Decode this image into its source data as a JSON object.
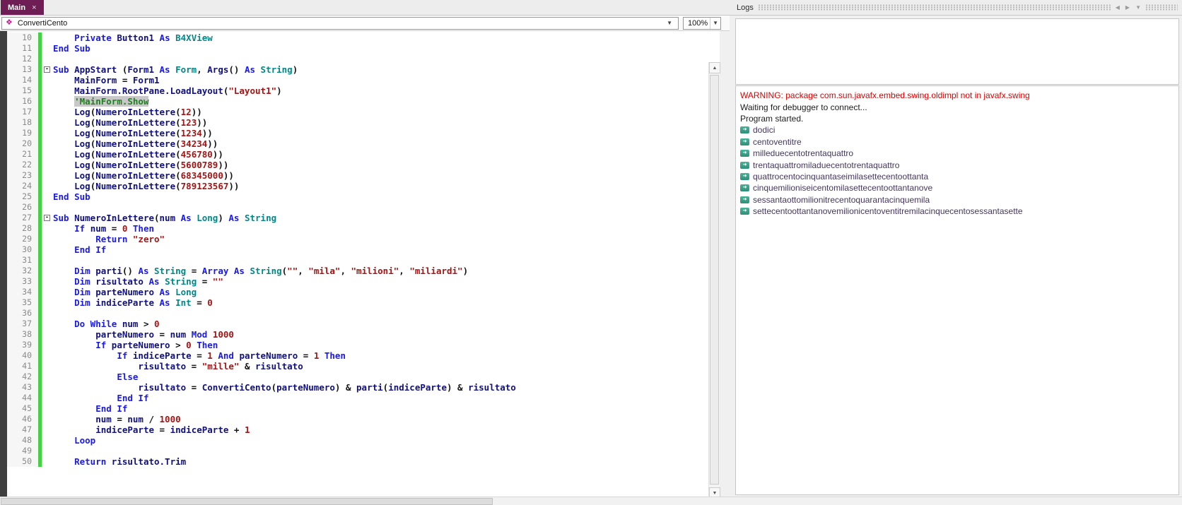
{
  "header": {
    "tabs": [
      {
        "label": "Main",
        "close_glyph": "×"
      }
    ],
    "nav": {
      "prev_glyph": "◀",
      "next_glyph": "▶",
      "menu_glyph": "▼"
    }
  },
  "toolbar": {
    "sub_selector_value": "ConvertiCento",
    "sub_icon_glyph": "❖",
    "zoom_value": "100%",
    "dropdown_glyph": "▼"
  },
  "scroll": {
    "up_glyph": "▲",
    "down_glyph": "▼"
  },
  "colors": {
    "active_tab_bg": "#6e1d55",
    "keyword": "#1a1ae6",
    "type": "#008888",
    "identifier": "#10107e",
    "literal": "#a31515",
    "comment": "#1e801e",
    "comment_highlight_bg": "#c8c8c8",
    "change_bar": "#44d144",
    "warning_text": "#dc0000",
    "log_output_text": "#44365e",
    "sub_icon": "#bf1d95"
  },
  "editor": {
    "fold_glyph": "-",
    "lines": [
      {
        "n": 10,
        "g": true,
        "f": false,
        "tk": [
          [
            "p",
            "    "
          ],
          [
            "k",
            "Private "
          ],
          [
            "i",
            "Button1 "
          ],
          [
            "k",
            "As "
          ],
          [
            "y",
            "B4XView"
          ]
        ]
      },
      {
        "n": 11,
        "g": true,
        "f": false,
        "tk": [
          [
            "k",
            "End Sub"
          ]
        ]
      },
      {
        "n": 12,
        "g": true,
        "f": false,
        "tk": []
      },
      {
        "n": 13,
        "g": true,
        "f": true,
        "tk": [
          [
            "k",
            "Sub "
          ],
          [
            "i",
            "AppStart "
          ],
          [
            "p",
            "("
          ],
          [
            "i",
            "Form1 "
          ],
          [
            "k",
            "As "
          ],
          [
            "y",
            "Form"
          ],
          [
            "p",
            ", "
          ],
          [
            "i",
            "Args"
          ],
          [
            "p",
            "() "
          ],
          [
            "k",
            "As "
          ],
          [
            "y",
            "String"
          ],
          [
            "p",
            ")"
          ]
        ]
      },
      {
        "n": 14,
        "g": true,
        "f": false,
        "tk": [
          [
            "p",
            "    "
          ],
          [
            "i",
            "MainForm"
          ],
          [
            "p",
            " = "
          ],
          [
            "i",
            "Form1"
          ]
        ]
      },
      {
        "n": 15,
        "g": true,
        "f": false,
        "tk": [
          [
            "p",
            "    "
          ],
          [
            "i",
            "MainForm.RootPane.LoadLayout"
          ],
          [
            "p",
            "("
          ],
          [
            "s",
            "\"Layout1\""
          ],
          [
            "p",
            ")"
          ]
        ]
      },
      {
        "n": 16,
        "g": true,
        "f": false,
        "tk": [
          [
            "p",
            "    "
          ],
          [
            "h",
            "'MainForm.Show"
          ]
        ]
      },
      {
        "n": 17,
        "g": true,
        "f": false,
        "tk": [
          [
            "p",
            "    "
          ],
          [
            "i",
            "Log"
          ],
          [
            "p",
            "("
          ],
          [
            "i",
            "NumeroInLettere"
          ],
          [
            "p",
            "("
          ],
          [
            "n",
            "12"
          ],
          [
            "p",
            "))"
          ]
        ]
      },
      {
        "n": 18,
        "g": true,
        "f": false,
        "tk": [
          [
            "p",
            "    "
          ],
          [
            "i",
            "Log"
          ],
          [
            "p",
            "("
          ],
          [
            "i",
            "NumeroInLettere"
          ],
          [
            "p",
            "("
          ],
          [
            "n",
            "123"
          ],
          [
            "p",
            "))"
          ]
        ]
      },
      {
        "n": 19,
        "g": true,
        "f": false,
        "tk": [
          [
            "p",
            "    "
          ],
          [
            "i",
            "Log"
          ],
          [
            "p",
            "("
          ],
          [
            "i",
            "NumeroInLettere"
          ],
          [
            "p",
            "("
          ],
          [
            "n",
            "1234"
          ],
          [
            "p",
            "))"
          ]
        ]
      },
      {
        "n": 20,
        "g": true,
        "f": false,
        "tk": [
          [
            "p",
            "    "
          ],
          [
            "i",
            "Log"
          ],
          [
            "p",
            "("
          ],
          [
            "i",
            "NumeroInLettere"
          ],
          [
            "p",
            "("
          ],
          [
            "n",
            "34234"
          ],
          [
            "p",
            "))"
          ]
        ]
      },
      {
        "n": 21,
        "g": true,
        "f": false,
        "tk": [
          [
            "p",
            "    "
          ],
          [
            "i",
            "Log"
          ],
          [
            "p",
            "("
          ],
          [
            "i",
            "NumeroInLettere"
          ],
          [
            "p",
            "("
          ],
          [
            "n",
            "456780"
          ],
          [
            "p",
            "))"
          ]
        ]
      },
      {
        "n": 22,
        "g": true,
        "f": false,
        "tk": [
          [
            "p",
            "    "
          ],
          [
            "i",
            "Log"
          ],
          [
            "p",
            "("
          ],
          [
            "i",
            "NumeroInLettere"
          ],
          [
            "p",
            "("
          ],
          [
            "n",
            "5600789"
          ],
          [
            "p",
            "))"
          ]
        ]
      },
      {
        "n": 23,
        "g": true,
        "f": false,
        "tk": [
          [
            "p",
            "    "
          ],
          [
            "i",
            "Log"
          ],
          [
            "p",
            "("
          ],
          [
            "i",
            "NumeroInLettere"
          ],
          [
            "p",
            "("
          ],
          [
            "n",
            "68345000"
          ],
          [
            "p",
            "))"
          ]
        ]
      },
      {
        "n": 24,
        "g": true,
        "f": false,
        "tk": [
          [
            "p",
            "    "
          ],
          [
            "i",
            "Log"
          ],
          [
            "p",
            "("
          ],
          [
            "i",
            "NumeroInLettere"
          ],
          [
            "p",
            "("
          ],
          [
            "n",
            "789123567"
          ],
          [
            "p",
            "))"
          ]
        ]
      },
      {
        "n": 25,
        "g": true,
        "f": false,
        "tk": [
          [
            "k",
            "End Sub"
          ]
        ]
      },
      {
        "n": 26,
        "g": true,
        "f": false,
        "tk": []
      },
      {
        "n": 27,
        "g": true,
        "f": true,
        "tk": [
          [
            "k",
            "Sub "
          ],
          [
            "i",
            "NumeroInLettere"
          ],
          [
            "p",
            "("
          ],
          [
            "i",
            "num "
          ],
          [
            "k",
            "As "
          ],
          [
            "y",
            "Long"
          ],
          [
            "p",
            ") "
          ],
          [
            "k",
            "As "
          ],
          [
            "y",
            "String"
          ]
        ]
      },
      {
        "n": 28,
        "g": true,
        "f": false,
        "tk": [
          [
            "p",
            "    "
          ],
          [
            "k",
            "If "
          ],
          [
            "i",
            "num"
          ],
          [
            "p",
            " = "
          ],
          [
            "n",
            "0"
          ],
          [
            "k",
            " Then"
          ]
        ]
      },
      {
        "n": 29,
        "g": true,
        "f": false,
        "tk": [
          [
            "p",
            "        "
          ],
          [
            "k",
            "Return "
          ],
          [
            "s",
            "\"zero\""
          ]
        ]
      },
      {
        "n": 30,
        "g": true,
        "f": false,
        "tk": [
          [
            "p",
            "    "
          ],
          [
            "k",
            "End If"
          ]
        ]
      },
      {
        "n": 31,
        "g": true,
        "f": false,
        "tk": []
      },
      {
        "n": 32,
        "g": true,
        "f": false,
        "tk": [
          [
            "p",
            "    "
          ],
          [
            "k",
            "Dim "
          ],
          [
            "i",
            "parti"
          ],
          [
            "p",
            "() "
          ],
          [
            "k",
            "As "
          ],
          [
            "y",
            "String"
          ],
          [
            "p",
            " = "
          ],
          [
            "k",
            "Array As "
          ],
          [
            "y",
            "String"
          ],
          [
            "p",
            "("
          ],
          [
            "s",
            "\"\""
          ],
          [
            "p",
            ", "
          ],
          [
            "s",
            "\"mila\""
          ],
          [
            "p",
            ", "
          ],
          [
            "s",
            "\"milioni\""
          ],
          [
            "p",
            ", "
          ],
          [
            "s",
            "\"miliardi\""
          ],
          [
            "p",
            ")"
          ]
        ]
      },
      {
        "n": 33,
        "g": true,
        "f": false,
        "tk": [
          [
            "p",
            "    "
          ],
          [
            "k",
            "Dim "
          ],
          [
            "i",
            "risultato "
          ],
          [
            "k",
            "As "
          ],
          [
            "y",
            "String"
          ],
          [
            "p",
            " = "
          ],
          [
            "s",
            "\"\""
          ]
        ]
      },
      {
        "n": 34,
        "g": true,
        "f": false,
        "tk": [
          [
            "p",
            "    "
          ],
          [
            "k",
            "Dim "
          ],
          [
            "i",
            "parteNumero "
          ],
          [
            "k",
            "As "
          ],
          [
            "y",
            "Long"
          ]
        ]
      },
      {
        "n": 35,
        "g": true,
        "f": false,
        "tk": [
          [
            "p",
            "    "
          ],
          [
            "k",
            "Dim "
          ],
          [
            "i",
            "indiceParte "
          ],
          [
            "k",
            "As "
          ],
          [
            "y",
            "Int"
          ],
          [
            "p",
            " = "
          ],
          [
            "n",
            "0"
          ]
        ]
      },
      {
        "n": 36,
        "g": true,
        "f": false,
        "tk": []
      },
      {
        "n": 37,
        "g": true,
        "f": false,
        "tk": [
          [
            "p",
            "    "
          ],
          [
            "k",
            "Do While "
          ],
          [
            "i",
            "num"
          ],
          [
            "p",
            " > "
          ],
          [
            "n",
            "0"
          ]
        ]
      },
      {
        "n": 38,
        "g": true,
        "f": false,
        "tk": [
          [
            "p",
            "        "
          ],
          [
            "i",
            "parteNumero"
          ],
          [
            "p",
            " = "
          ],
          [
            "i",
            "num "
          ],
          [
            "k",
            "Mod "
          ],
          [
            "n",
            "1000"
          ]
        ]
      },
      {
        "n": 39,
        "g": true,
        "f": false,
        "tk": [
          [
            "p",
            "        "
          ],
          [
            "k",
            "If "
          ],
          [
            "i",
            "parteNumero"
          ],
          [
            "p",
            " > "
          ],
          [
            "n",
            "0"
          ],
          [
            "k",
            " Then"
          ]
        ]
      },
      {
        "n": 40,
        "g": true,
        "f": false,
        "tk": [
          [
            "p",
            "            "
          ],
          [
            "k",
            "If "
          ],
          [
            "i",
            "indiceParte"
          ],
          [
            "p",
            " = "
          ],
          [
            "n",
            "1"
          ],
          [
            "k",
            " And "
          ],
          [
            "i",
            "parteNumero"
          ],
          [
            "p",
            " = "
          ],
          [
            "n",
            "1"
          ],
          [
            "k",
            " Then"
          ]
        ]
      },
      {
        "n": 41,
        "g": true,
        "f": false,
        "tk": [
          [
            "p",
            "                "
          ],
          [
            "i",
            "risultato"
          ],
          [
            "p",
            " = "
          ],
          [
            "s",
            "\"mille\""
          ],
          [
            "p",
            " & "
          ],
          [
            "i",
            "risultato"
          ]
        ]
      },
      {
        "n": 42,
        "g": true,
        "f": false,
        "tk": [
          [
            "p",
            "            "
          ],
          [
            "k",
            "Else"
          ]
        ]
      },
      {
        "n": 43,
        "g": true,
        "f": false,
        "tk": [
          [
            "p",
            "                "
          ],
          [
            "i",
            "risultato"
          ],
          [
            "p",
            " = "
          ],
          [
            "i",
            "ConvertiCento"
          ],
          [
            "p",
            "("
          ],
          [
            "i",
            "parteNumero"
          ],
          [
            "p",
            ") & "
          ],
          [
            "i",
            "parti"
          ],
          [
            "p",
            "("
          ],
          [
            "i",
            "indiceParte"
          ],
          [
            "p",
            ") & "
          ],
          [
            "i",
            "risultato"
          ]
        ]
      },
      {
        "n": 44,
        "g": true,
        "f": false,
        "tk": [
          [
            "p",
            "            "
          ],
          [
            "k",
            "End If"
          ]
        ]
      },
      {
        "n": 45,
        "g": true,
        "f": false,
        "tk": [
          [
            "p",
            "        "
          ],
          [
            "k",
            "End If"
          ]
        ]
      },
      {
        "n": 46,
        "g": true,
        "f": false,
        "tk": [
          [
            "p",
            "        "
          ],
          [
            "i",
            "num"
          ],
          [
            "p",
            " = "
          ],
          [
            "i",
            "num"
          ],
          [
            "p",
            " / "
          ],
          [
            "n",
            "1000"
          ]
        ]
      },
      {
        "n": 47,
        "g": true,
        "f": false,
        "tk": [
          [
            "p",
            "        "
          ],
          [
            "i",
            "indiceParte"
          ],
          [
            "p",
            " = "
          ],
          [
            "i",
            "indiceParte"
          ],
          [
            "p",
            " + "
          ],
          [
            "n",
            "1"
          ]
        ]
      },
      {
        "n": 48,
        "g": true,
        "f": false,
        "tk": [
          [
            "p",
            "    "
          ],
          [
            "k",
            "Loop"
          ]
        ]
      },
      {
        "n": 49,
        "g": true,
        "f": false,
        "tk": []
      },
      {
        "n": 50,
        "g": true,
        "f": false,
        "tk": [
          [
            "p",
            "    "
          ],
          [
            "k",
            "Return "
          ],
          [
            "i",
            "risultato.Trim"
          ]
        ]
      }
    ]
  },
  "logs": {
    "title": "Logs",
    "icon_glyph": "➜",
    "entries": [
      {
        "kind": "warn",
        "icon": false,
        "text": "WARNING: package com.sun.javafx.embed.swing.oldimpl not in javafx.swing"
      },
      {
        "kind": "plain",
        "icon": false,
        "text": "Waiting for debugger to connect..."
      },
      {
        "kind": "plain",
        "icon": false,
        "text": "Program started."
      },
      {
        "kind": "out",
        "icon": true,
        "text": "dodici"
      },
      {
        "kind": "out",
        "icon": true,
        "text": "centoventitre"
      },
      {
        "kind": "out",
        "icon": true,
        "text": "milleduecentotrentaquattro"
      },
      {
        "kind": "out",
        "icon": true,
        "text": "trentaquattromiladuecentotrentaquattro"
      },
      {
        "kind": "out",
        "icon": true,
        "text": "quattrocentocinquantaseimilasettecentoottanta"
      },
      {
        "kind": "out",
        "icon": true,
        "text": "cinquemilioniseicentomilasettecentoottantanove"
      },
      {
        "kind": "out",
        "icon": true,
        "text": "sessantaottomilionitrecentoquarantacinquemila"
      },
      {
        "kind": "out",
        "icon": true,
        "text": "settecentoottantanovemilionicentoventitremilacinquecentosessantasette"
      }
    ]
  }
}
